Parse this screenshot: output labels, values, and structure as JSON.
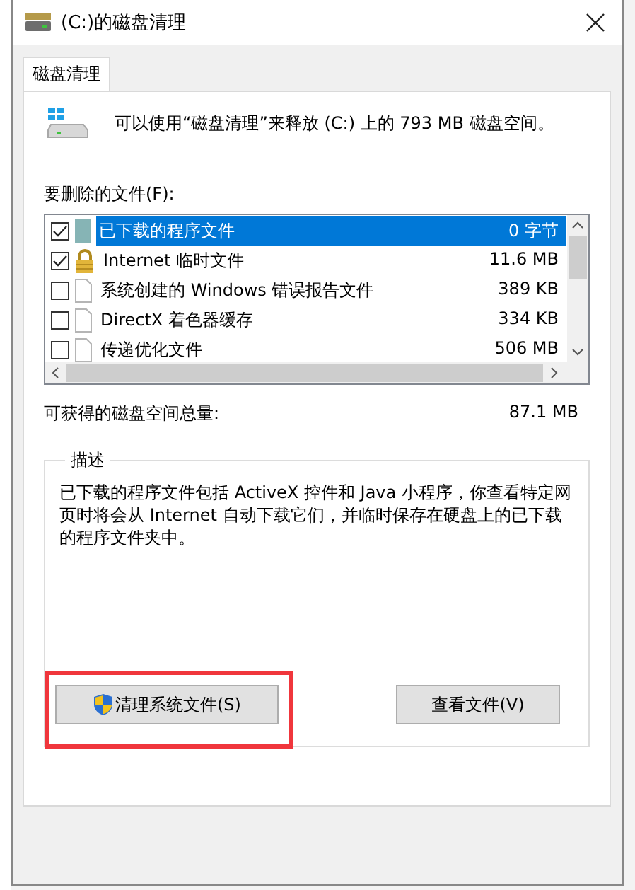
{
  "window": {
    "title": "(C:)的磁盘清理"
  },
  "tabs": [
    {
      "label": "磁盘清理",
      "selected": true
    }
  ],
  "intro": "可以使用“磁盘清理”来释放  (C:) 上的 793 MB 磁盘空间。",
  "files_label": "要删除的文件(F):",
  "files": [
    {
      "name": "已下载的程序文件",
      "size": "0 字节",
      "checked": true,
      "selected": true,
      "kind": "folder"
    },
    {
      "name": "Internet 临时文件",
      "size": "11.6 MB",
      "checked": true,
      "selected": false,
      "kind": "lock"
    },
    {
      "name": "系统创建的 Windows 错误报告文件",
      "size": "389 KB",
      "checked": false,
      "selected": false,
      "kind": "file"
    },
    {
      "name": "DirectX 着色器缓存",
      "size": "334 KB",
      "checked": false,
      "selected": false,
      "kind": "file"
    },
    {
      "name": "传递优化文件",
      "size": "506 MB",
      "checked": false,
      "selected": false,
      "kind": "file"
    }
  ],
  "total_label": "可获得的磁盘空间总量:",
  "total_value": "87.1 MB",
  "description": {
    "title": "描述",
    "text": "已下载的程序文件包括 ActiveX 控件和 Java 小程序，你查看特定网页时将会从 Internet 自动下载它们，并临时保存在硬盘上的已下载的程序文件夹中。"
  },
  "buttons": [
    {
      "label": "清理系统文件(S)",
      "kind": "shield",
      "highlighted": true
    },
    {
      "label": "查看文件(V)",
      "kind": "plain",
      "highlighted": false
    }
  ]
}
